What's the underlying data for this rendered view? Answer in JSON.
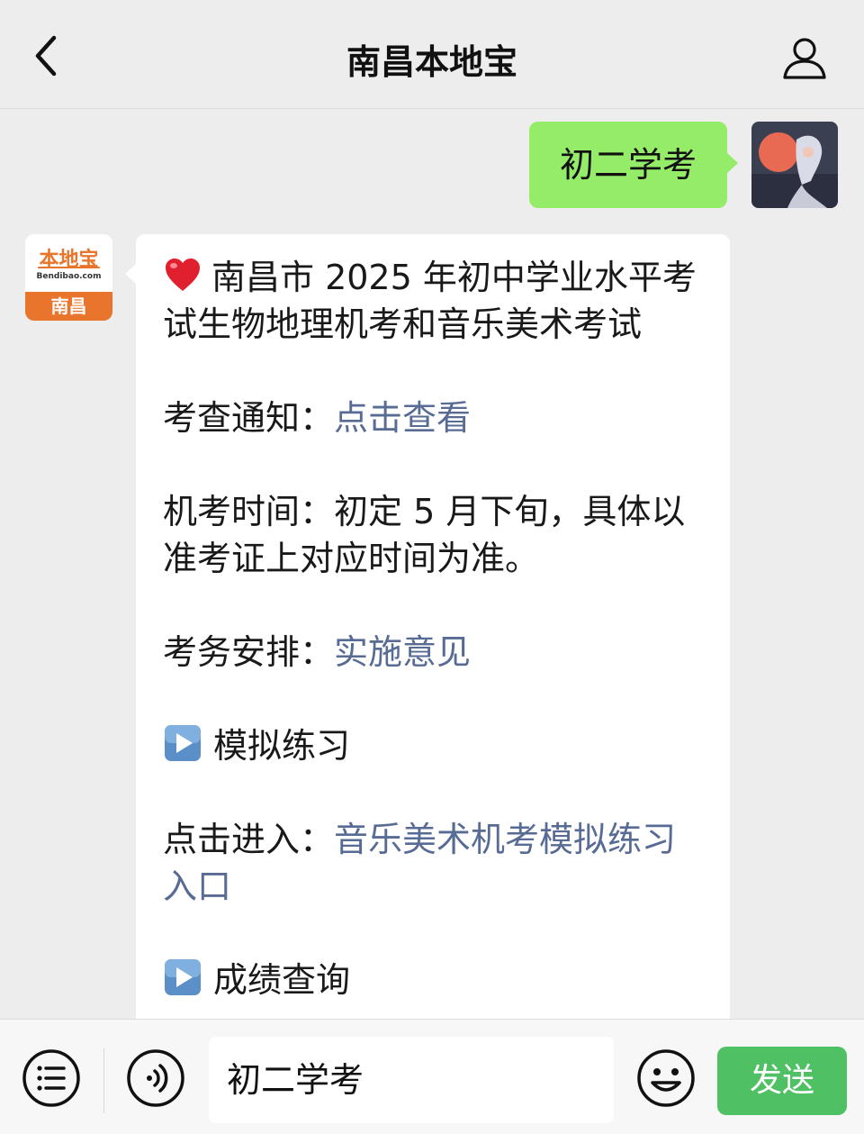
{
  "header": {
    "title": "南昌本地宝"
  },
  "user_message": {
    "text": "初二学考"
  },
  "bot_avatar": {
    "logo_text": "本地宝",
    "site_text": "Bendibao.com",
    "city_text": "南昌"
  },
  "bot_message": {
    "headline": "南昌市 2025 年初中学业水平考试生物地理机考和音乐美术考试",
    "notice_label": "考查通知：",
    "notice_link": "点击查看",
    "exam_time_text": "机考时间：初定 5 月下旬，具体以准考证上对应时间为准。",
    "arrangement_label": "考务安排：",
    "arrangement_link": "实施意见",
    "practice_heading": "模拟练习",
    "practice_label": "点击进入：",
    "practice_link": "音乐美术机考模拟练习入口",
    "score_heading": "成绩查询"
  },
  "input_bar": {
    "text": "初二学考",
    "send_label": "发送"
  },
  "colors": {
    "background": "#ededed",
    "user_bubble": "#95ec69",
    "link": "#576b95",
    "send_button": "#4fc064",
    "logo_orange": "#e8752b"
  }
}
